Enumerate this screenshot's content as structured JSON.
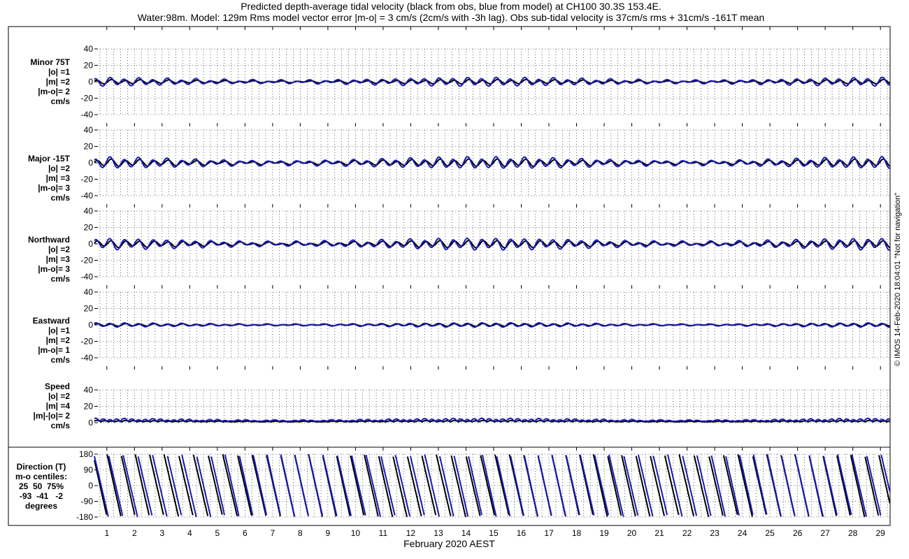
{
  "title_line1": "Predicted depth-average tidal velocity (black from obs, blue from model) at CH100 30.3S 153.4E.",
  "title_line2": "Water:98m. Model: 129m  Rms model vector error |m-o| = 3 cm/s (2cm/s with -3h lag). Obs sub-tidal velocity is 37cm/s rms + 31cm/s -161T mean",
  "watermark": "© IMOS 14-Feb-2020 18:04:01  \"Not for navigation\"",
  "x_axis_label": "February 2020 AEST",
  "colors": {
    "obs": "#000000",
    "model": "#1a1ab4",
    "grid": "#000000"
  },
  "chart_data": {
    "type": "line",
    "x_day_ticks": [
      "1",
      "2",
      "3",
      "4",
      "5",
      "6",
      "7",
      "8",
      "9",
      "10",
      "11",
      "12",
      "13",
      "14",
      "15",
      "16",
      "17",
      "18",
      "19",
      "20",
      "21",
      "22",
      "23",
      "24",
      "25",
      "26",
      "27",
      "28",
      "29"
    ],
    "xlim_days": [
      0.55,
      29.35
    ],
    "series_names_note_from_title": [
      "black from obs",
      "blue from model"
    ],
    "panels": [
      {
        "id": "minor",
        "label_lines": [
          "Minor 75T",
          "|o| =1",
          "|m| =2",
          "|m-o|= 2",
          "cm/s"
        ],
        "ylim": [
          -40,
          40
        ],
        "yticks": [
          "40",
          "20",
          "0",
          "-20",
          "-40"
        ],
        "obs": {
          "semidiurnal_amp": 1.5,
          "offset": 0
        },
        "model": {
          "semidiurnal_amp": 3,
          "offset": 0
        }
      },
      {
        "id": "major",
        "label_lines": [
          "Major -15T",
          "|o| =2",
          "|m| =3",
          "|m-o|= 3",
          "cm/s"
        ],
        "ylim": [
          -40,
          40
        ],
        "yticks": [
          "40",
          "20",
          "0",
          "-20",
          "-40"
        ],
        "obs": {
          "semidiurnal_amp": 2.5,
          "offset": 0
        },
        "model": {
          "semidiurnal_amp": 4,
          "offset": 0
        }
      },
      {
        "id": "northward",
        "label_lines": [
          "Northward",
          "|o| =2",
          "|m| =3",
          "|m-o|= 3",
          "cm/s"
        ],
        "ylim": [
          -40,
          40
        ],
        "yticks": [
          "40",
          "20",
          "0",
          "-20",
          "-40"
        ],
        "obs": {
          "semidiurnal_amp": 2.5,
          "offset": 0
        },
        "model": {
          "semidiurnal_amp": 4,
          "offset": 0
        }
      },
      {
        "id": "eastward",
        "label_lines": [
          "Eastward",
          "|o| =1",
          "|m| =2",
          "|m-o|= 1",
          "cm/s"
        ],
        "ylim": [
          -40,
          40
        ],
        "yticks": [
          "40",
          "20",
          "0",
          "-20",
          "-40"
        ],
        "obs": {
          "semidiurnal_amp": 1,
          "offset": 0
        },
        "model": {
          "semidiurnal_amp": 1.5,
          "offset": 0
        }
      },
      {
        "id": "speed",
        "label_lines": [
          "Speed",
          "|o| =2",
          "|m| =4",
          "|m|-|o|= 2",
          "cm/s"
        ],
        "ylim": [
          0,
          40
        ],
        "yticks": [
          "40",
          "20",
          "0"
        ],
        "obs": {
          "semidiurnal_amp": 1,
          "offset": 2
        },
        "model": {
          "semidiurnal_amp": 2,
          "offset": 3.5
        }
      },
      {
        "id": "direction",
        "label_lines": [
          "Direction (T)",
          "m-o centiles:",
          "25  50  75%",
          "-93  -41   -2",
          "degrees"
        ],
        "ylim": [
          -180,
          180
        ],
        "yticks": [
          "180",
          "90",
          "0",
          "-90",
          "-180"
        ],
        "obs": {
          "type": "rotating_direction",
          "period_hours": 12.42,
          "phase_deg": 0
        },
        "model": {
          "type": "rotating_direction",
          "period_hours": 12.42,
          "phase_deg": -41
        }
      }
    ]
  }
}
